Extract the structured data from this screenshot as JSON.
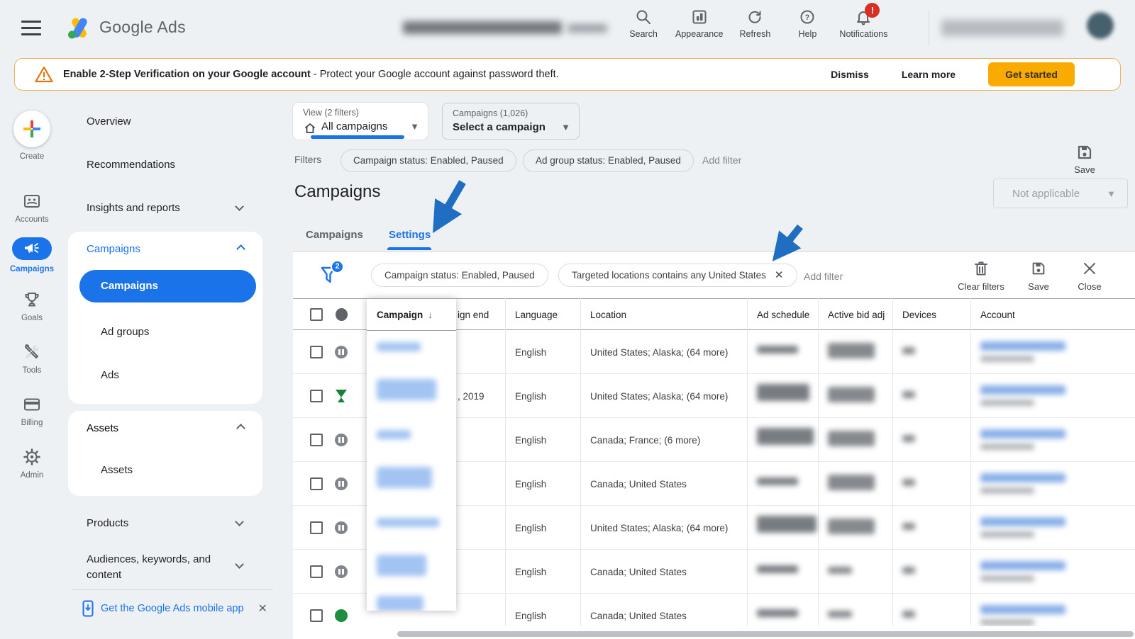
{
  "topbar": {
    "brand": "Google Ads",
    "nav": [
      {
        "label": "Search"
      },
      {
        "label": "Appearance"
      },
      {
        "label": "Refresh"
      },
      {
        "label": "Help"
      },
      {
        "label": "Notifications"
      }
    ],
    "notification_badge": "!"
  },
  "banner": {
    "title": "Enable 2-Step Verification on your Google account",
    "description": " - Protect your Google account against password theft.",
    "dismiss": "Dismiss",
    "learn_more": "Learn more",
    "get_started": "Get started"
  },
  "rail": {
    "items": [
      {
        "label": "Create"
      },
      {
        "label": "Accounts"
      },
      {
        "label": "Campaigns"
      },
      {
        "label": "Goals"
      },
      {
        "label": "Tools"
      },
      {
        "label": "Billing"
      },
      {
        "label": "Admin"
      }
    ]
  },
  "nav": {
    "overview": "Overview",
    "recommendations": "Recommendations",
    "insights": "Insights and reports",
    "campaigns_group": "Campaigns",
    "campaigns_item": "Campaigns",
    "ad_groups": "Ad groups",
    "ads": "Ads",
    "assets_group": "Assets",
    "assets_item": "Assets",
    "products": "Products",
    "audiences": "Audiences, keywords, and content",
    "mobile_app": "Get the Google Ads mobile app"
  },
  "toolbar": {
    "view_label": "View (2 filters)",
    "view_value": "All campaigns",
    "campaign_label": "Campaigns (1,026)",
    "campaign_value": "Select a campaign",
    "filters_label": "Filters",
    "filter_chips": [
      "Campaign status: Enabled, Paused",
      "Ad group status: Enabled, Paused"
    ],
    "add_filter": "Add filter",
    "save": "Save",
    "not_applicable": "Not applicable"
  },
  "page": {
    "title": "Campaigns",
    "tabs": [
      "Campaigns",
      "Settings"
    ],
    "active_tab": "Settings"
  },
  "filter_bar": {
    "badge": "2",
    "chips": [
      "Campaign status: Enabled, Paused",
      "Targeted locations contains any United States"
    ],
    "add_filter": "Add filter",
    "clear_filters": "Clear filters",
    "save": "Save",
    "close": "Close"
  },
  "table": {
    "columns": [
      "Campaign",
      "ign end",
      "Language",
      "Location",
      "Ad schedule",
      "Active bid adj",
      "Devices",
      "Account"
    ],
    "sort_column": "Campaign",
    "rows": [
      {
        "status": "paused",
        "end": "",
        "language": "English",
        "location": "United States; Alaska; (64 more)"
      },
      {
        "status": "ended",
        "end": ", 2019",
        "language": "English",
        "location": "United States; Alaska; (64 more)"
      },
      {
        "status": "paused",
        "end": "",
        "language": "English",
        "location": "Canada; France; (6 more)"
      },
      {
        "status": "paused",
        "end": "",
        "language": "English",
        "location": "Canada; United States"
      },
      {
        "status": "paused",
        "end": "",
        "language": "English",
        "location": "United States; Alaska; (64 more)"
      },
      {
        "status": "paused",
        "end": "",
        "language": "English",
        "location": "Canada; United States"
      },
      {
        "status": "enabled",
        "end": "",
        "language": "English",
        "location": "Canada; United States"
      }
    ]
  },
  "colors": {
    "accent": "#1a73e8",
    "cta": "#f9ab00",
    "warning": "#e8710a",
    "enabled_green": "#1e8e3e",
    "annotation_arrow": "#1f6ec2",
    "notification_red": "#d93025"
  }
}
